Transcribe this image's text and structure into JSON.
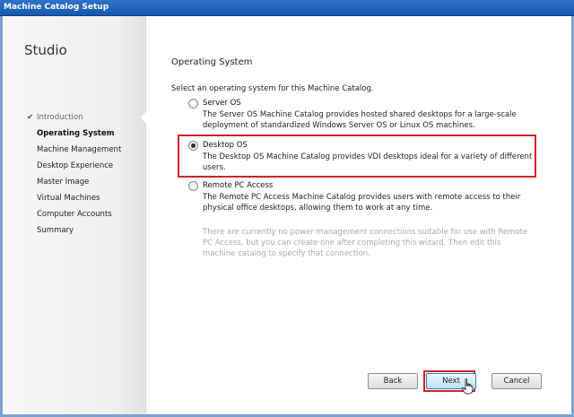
{
  "window": {
    "title": "Machine Catalog Setup"
  },
  "sidebar": {
    "brand": "Studio",
    "done_check": "✔",
    "steps": [
      {
        "label": "Introduction",
        "state": "done"
      },
      {
        "label": "Operating System",
        "state": "current"
      },
      {
        "label": "Machine Management",
        "state": "pending"
      },
      {
        "label": "Desktop Experience",
        "state": "pending"
      },
      {
        "label": "Master Image",
        "state": "pending"
      },
      {
        "label": "Virtual Machines",
        "state": "pending"
      },
      {
        "label": "Computer Accounts",
        "state": "pending"
      },
      {
        "label": "Summary",
        "state": "pending"
      }
    ]
  },
  "main": {
    "title": "Operating System",
    "prompt": "Select an operating system for this Machine Catalog.",
    "options": [
      {
        "label": "Server OS",
        "selected": false,
        "description": "The Server OS Machine Catalog provides hosted shared desktops for a large-scale deployment of standardized Windows Server OS or Linux OS machines."
      },
      {
        "label": "Desktop OS",
        "selected": true,
        "description": "The Desktop OS Machine Catalog provides VDI desktops ideal for a variety of different users."
      },
      {
        "label": "Remote PC Access",
        "selected": false,
        "description": "The Remote PC Access Machine Catalog provides users with remote access to their physical office desktops, allowing them to work at any time."
      }
    ],
    "note": "There are currently no power management connections suitable for use with Remote PC Access, but you can create one after completing this wizard. Then edit this machine catalog to specify that connection."
  },
  "footer": {
    "back_label": "Back",
    "next_label": "Next",
    "cancel_label": "Cancel"
  },
  "colors": {
    "titlebar": "#1857b0",
    "highlight": "#d0222a"
  }
}
